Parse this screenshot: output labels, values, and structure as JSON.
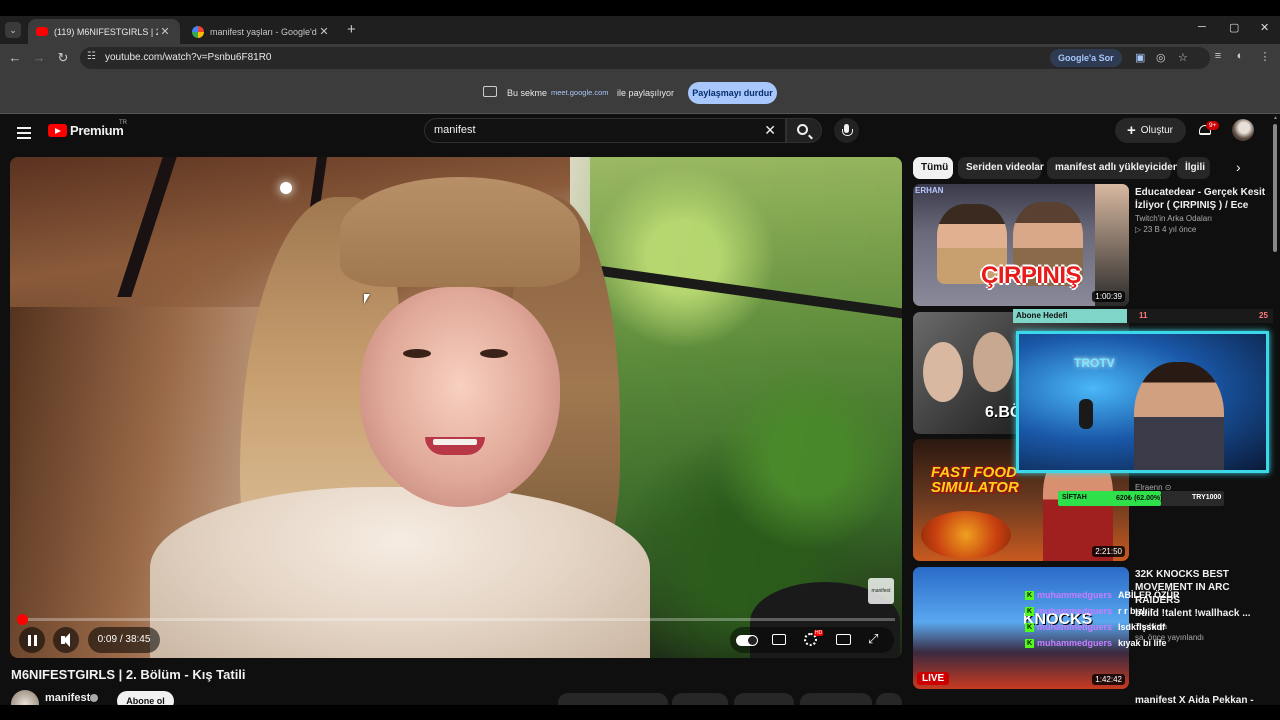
{
  "browser": {
    "tabs": [
      {
        "title": "(119) M6NIFESTGIRLS | 2. B",
        "active": true
      },
      {
        "title": "manifest yaşları - Google'da Ar",
        "active": false
      }
    ],
    "new_tab": "+",
    "url": "youtube.com/watch?v=Psnbu6F81R0",
    "google_ask": "Google'a Sor",
    "win_min": "─",
    "win_max": "▢",
    "win_close": "✕"
  },
  "share_bar": {
    "prefix": "Bu sekme",
    "domain": "meet.google.com",
    "suffix": "ile paylaşılıyor",
    "stop_button": "Paylaşmayı durdur"
  },
  "youtube": {
    "logo_text": "Premium",
    "region": "TR",
    "search_value": "manifest",
    "create_label": "Oluştur",
    "notifications_badge": "9+"
  },
  "player": {
    "time": "0:09 / 38:45",
    "progress": 0.0039,
    "watermark": "manifest",
    "hd_badge": "HD"
  },
  "video": {
    "title": "M6NIFESTGIRLS | 2. Bölüm - Kış Tatili",
    "channel": "manifest",
    "subscribe_label": "Abone ol"
  },
  "chips": [
    "Tümü",
    "Seriden videolar",
    "manifest adlı yükleyiciden",
    "İlgili"
  ],
  "recommendations": [
    {
      "title_line1": "Educatedear - Gerçek Kesit",
      "title_line2": "İzliyor ( ÇIRPINIŞ ) / Ece",
      "channel": "Twitch'in Arka Odaları",
      "meta": "23 B   4 yıl önce",
      "duration": "1:00:39",
      "thumb_text": "ÇIRPINIŞ",
      "thumb_tag": "ERHAN"
    },
    {
      "thumb_text": "6.BÖ"
    },
    {
      "channel": "Elraenn",
      "duration": "2:21:50",
      "thumb_text_1": "FAST FOOD",
      "thumb_text_2": "SIMULATOR"
    },
    {
      "title_line1": "32K KNOCKS BEST",
      "title_line2": "MOVEMENT IN ARC RAIDERS",
      "title_line3": "build !talent !wallhack ...",
      "channel": "TheNinja",
      "meta": "sa. önce yayınlandı",
      "duration": "1:42:42",
      "thumb_text": "KNOCKS",
      "live_label": "LIVE"
    },
    {
      "title_line1": "manifest X Aida Pekkan -"
    }
  ],
  "overlays": {
    "goal_label": "Abone Hedefi",
    "goal_current": "11",
    "goal_target": "25",
    "cam_sign": "TROTV",
    "bar_label": "SİFTAH",
    "bar_value": "620₺ (62.00%)",
    "bar_currency": "TRY1000",
    "chat": [
      {
        "user": "muhammedguers",
        "message": "ABİLER ÖZÜR"
      },
      {
        "user": "muhammedguers",
        "message": "r r bızlı r"
      },
      {
        "user": "muhammedguers",
        "message": "lsdkflşskdf"
      },
      {
        "user": "muhammedguers",
        "message": "kıyak bi life"
      }
    ]
  },
  "colors": {
    "accent_red": "#ff0000",
    "share_button": "#a8c7fa",
    "cam_border": "#3ad8e8",
    "donation_bar": "#2ee04a"
  }
}
